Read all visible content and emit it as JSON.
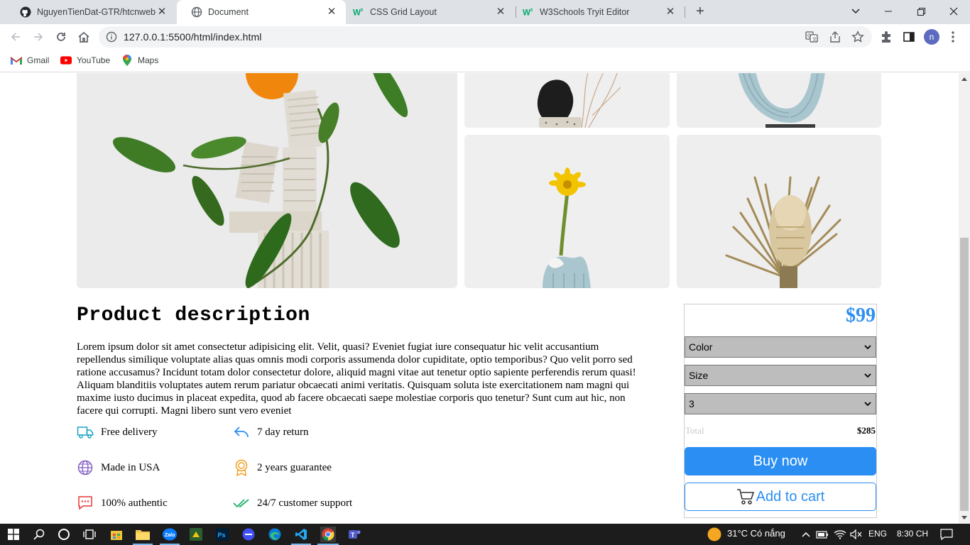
{
  "browser": {
    "tabs": [
      {
        "title": "NguyenTienDat-GTR/htcnweb-ba",
        "favicon": "github-icon",
        "active": false
      },
      {
        "title": "Document",
        "favicon": "globe-icon",
        "active": true
      },
      {
        "title": "CSS Grid Layout",
        "favicon": "w3schools-icon",
        "active": false
      },
      {
        "title": "W3Schools Tryit Editor",
        "favicon": "w3schools-icon",
        "active": false
      }
    ],
    "url": "127.0.0.1:5500/html/index.html",
    "profile_initial": "n",
    "bookmarks": [
      {
        "label": "Gmail",
        "icon": "gmail-icon"
      },
      {
        "label": "YouTube",
        "icon": "youtube-icon"
      },
      {
        "label": "Maps",
        "icon": "maps-icon"
      }
    ]
  },
  "gallery": {
    "images": [
      "orange-plant-sculpture",
      "black-vase-dry-branches",
      "blue-ceramic-sculpture",
      "yellow-flower-blue-vase",
      "dried-protea-flower"
    ]
  },
  "product": {
    "title": "Product description",
    "description": "Lorem ipsum dolor sit amet consectetur adipisicing elit. Velit, quasi? Eveniet fugiat iure consequatur hic velit accusantium repellendus similique voluptate alias quas omnis modi corporis assumenda dolor cupiditate, optio temporibus? Quo velit porro sed ratione accusamus? Incidunt totam dolor consectetur dolore, aliquid magni vitae aut tenetur optio sapiente perferendis rerum quasi! Aliquam blanditiis voluptates autem rerum pariatur obcaecati animi veritatis. Quisquam soluta iste exercitationem nam magni qui maxime iusto ducimus in placeat expedita, quod ab facere obcaecati saepe molestiae corporis quo tenetur? Sunt cum aut hic, non facere qui corrupti. Magni libero sunt vero eveniet",
    "features": [
      {
        "label": "Free delivery",
        "icon": "truck-icon",
        "color": "#1aa3c8"
      },
      {
        "label": "7 day return",
        "icon": "return-arrow-icon",
        "color": "#2b8ef3"
      },
      {
        "label": "Made in USA",
        "icon": "globe-icon",
        "color": "#7e57c2"
      },
      {
        "label": "2 years guarantee",
        "icon": "award-icon",
        "color": "#f0a020"
      },
      {
        "label": "100% authentic",
        "icon": "chat-dots-icon",
        "color": "#e53935"
      },
      {
        "label": "24/7 customer support",
        "icon": "double-check-icon",
        "color": "#1fb26b"
      }
    ]
  },
  "purchase": {
    "price": "$99",
    "color_select": "Color",
    "size_select": "Size",
    "quantity_select": "3",
    "total_label": "Total",
    "total_value": "$285",
    "buy_label": "Buy now",
    "cart_label": "Add to cart",
    "accent": "#2b8ef3"
  },
  "taskbar": {
    "weather": "31°C  Có nắng",
    "language": "ENG",
    "time": "8:30 CH"
  }
}
